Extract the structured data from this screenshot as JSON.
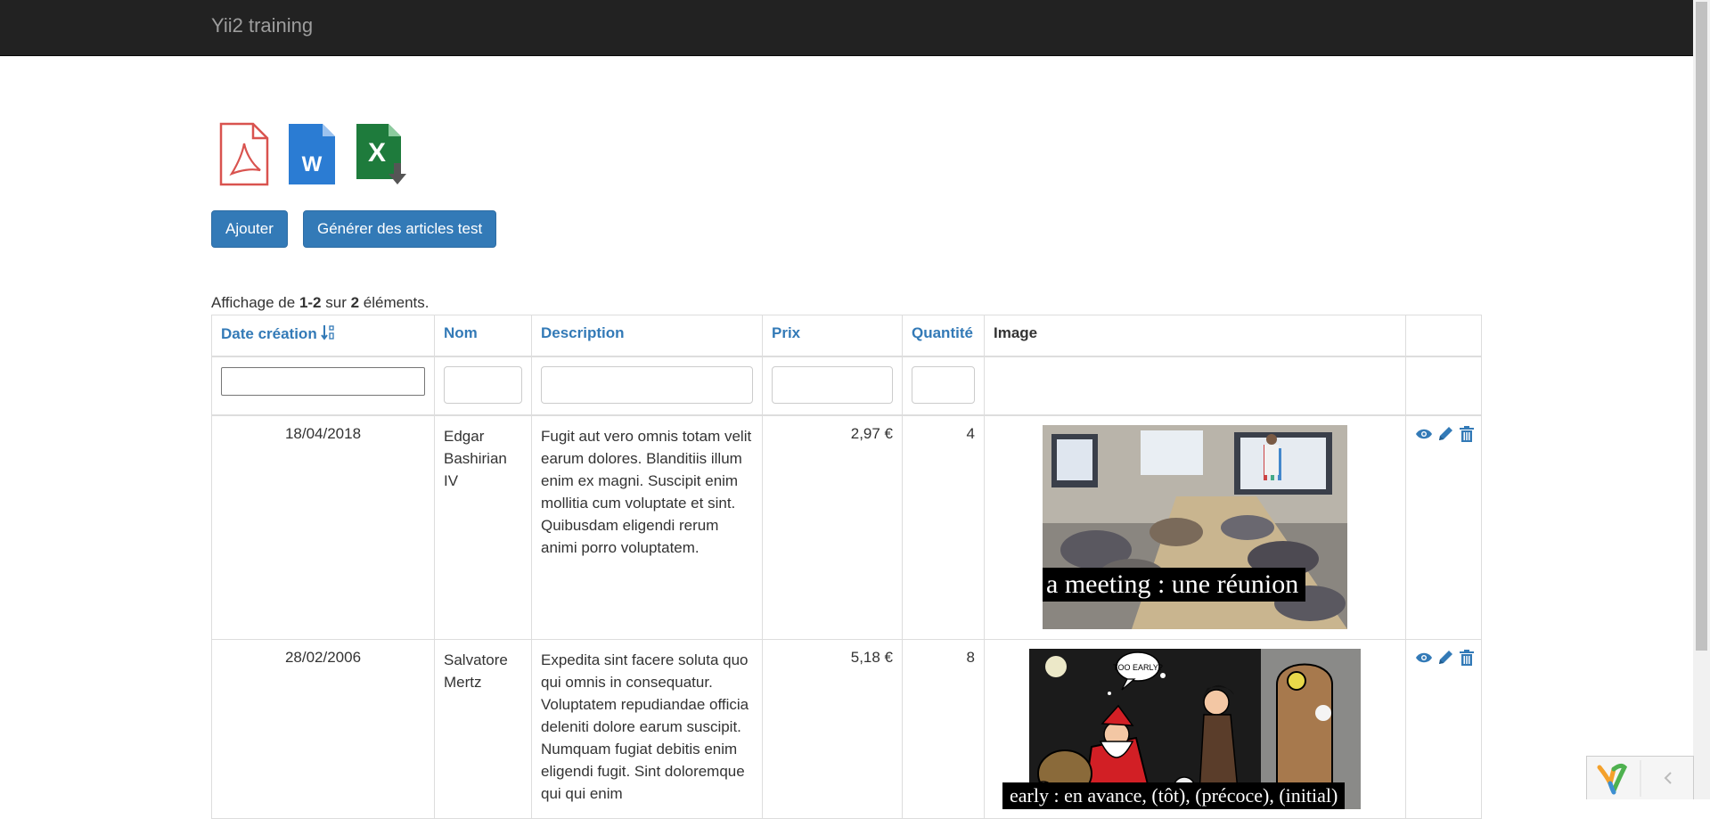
{
  "app": {
    "brand": "Yii2 training"
  },
  "exports": [
    {
      "name": "pdf-export-icon",
      "label": "PDF"
    },
    {
      "name": "word-export-icon",
      "label": "W"
    },
    {
      "name": "excel-export-icon",
      "label": "X"
    }
  ],
  "buttons": {
    "add": "Ajouter",
    "generate": "Générer des articles test"
  },
  "summary": {
    "prefix": "Affichage de ",
    "range": "1-2",
    "mid": " sur ",
    "total": "2",
    "suffix": " éléments."
  },
  "table": {
    "headers": {
      "date": "Date création",
      "nom": "Nom",
      "description": "Description",
      "prix": "Prix",
      "quantite": "Quantité",
      "image": "Image"
    },
    "rows": [
      {
        "date": "18/04/2018",
        "nom": "Edgar Bashirian IV",
        "description": "Fugit aut vero omnis totam velit earum dolores. Blanditiis illum enim ex magni. Suscipit enim mollitia cum voluptate et sint. Quibusdam eligendi rerum animi porro voluptatem.",
        "prix": "2,97 €",
        "quantite": "4",
        "image_caption": "a meeting : une réunion"
      },
      {
        "date": "28/02/2006",
        "nom": "Salvatore Mertz",
        "description": "Expedita sint facere soluta quo qui omnis in consequatur. Voluptatem repudiandae officia deleniti dolore earum suscipit. Numquam fugiat debitis enim eligendi fugit. Sint doloremque qui qui enim",
        "prix": "5,18 €",
        "quantite": "8",
        "image_caption": "early : en avance, (tôt), (précoce), (initial)",
        "image_bubble": "TOO EARLY?"
      }
    ]
  },
  "colors": {
    "navbar": "#222222",
    "primary": "#337ab7",
    "link": "#337ab7"
  }
}
